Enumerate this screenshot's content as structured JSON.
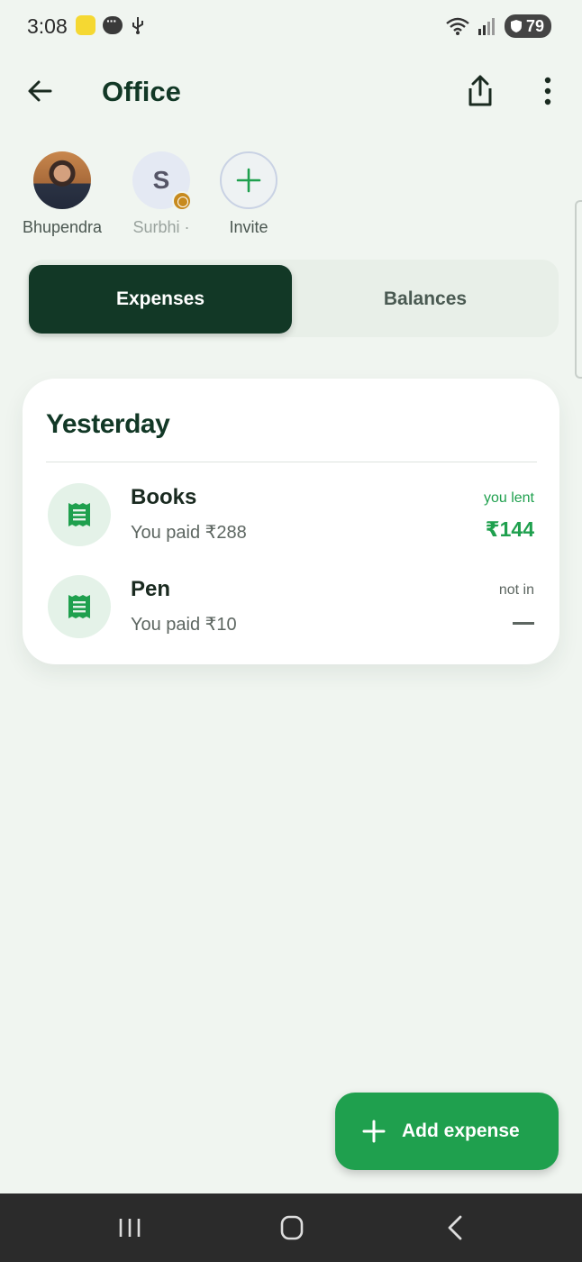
{
  "status_bar": {
    "time": "3:08",
    "battery": "79"
  },
  "app_bar": {
    "title": "Office",
    "icons": [
      "arrow-left-icon",
      "share-icon",
      "more-vertical-icon"
    ]
  },
  "members": [
    {
      "name": "Bhupendra",
      "avatar": "photo"
    },
    {
      "name": "Surbhi ·",
      "initial": "S",
      "pending": true
    },
    {
      "name": "Invite",
      "avatar": "plus-icon"
    }
  ],
  "tabs": [
    {
      "label": "Expenses",
      "active": true
    },
    {
      "label": "Balances",
      "active": false
    }
  ],
  "expenses": {
    "section_title": "Yesterday",
    "items": [
      {
        "name": "Books",
        "subtitle": "You paid ₹288",
        "status": "you lent",
        "amount": "₹144"
      },
      {
        "name": "Pen",
        "subtitle": "You paid ₹10",
        "status": "not in",
        "amount": null
      }
    ]
  },
  "fab": {
    "label": "Add expense",
    "icon": "plus-icon"
  },
  "colors": {
    "brand_dark": "#123826",
    "accent_green": "#1fa04e",
    "background": "#f0f5f0"
  }
}
